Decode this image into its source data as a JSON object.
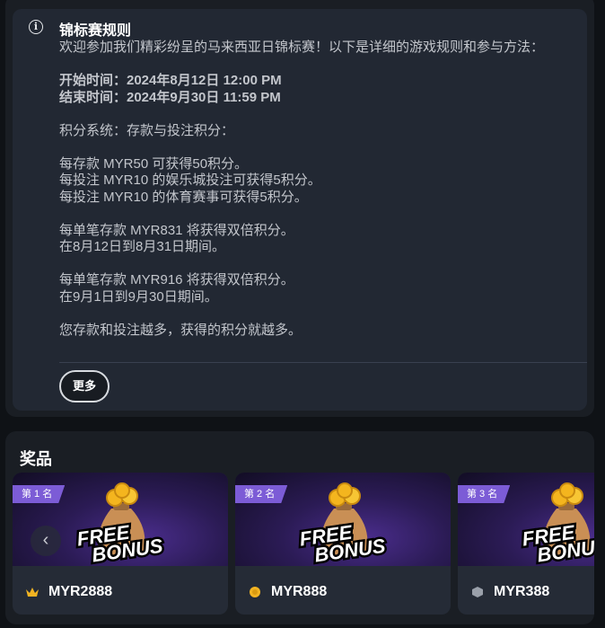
{
  "rules": {
    "title": "锦标赛规则",
    "intro": "欢迎参加我们精彩纷呈的马来西亚日锦标赛！以下是详细的游戏规则和参与方法：",
    "start_time": "开始时间：2024年8月12日 12:00 PM",
    "end_time": "结束时间：2024年9月30日 11:59 PM",
    "points_system": "积分系统：存款与投注积分：",
    "points_rules": [
      "每存款 MYR50 可获得50积分。",
      "每投注 MYR10 的娱乐城投注可获得5积分。",
      "每投注 MYR10 的体育赛事可获得5积分。"
    ],
    "double_1_line1": "每单笔存款 MYR831 将获得双倍积分。",
    "double_1_line2": "在8月12日到8月31日期间。",
    "double_2_line1": "每单笔存款 MYR916 将获得双倍积分。",
    "double_2_line2": "在9月1日到9月30日期间。",
    "closing": "您存款和投注越多，获得的积分就越多。",
    "more_button": "更多"
  },
  "prizes": {
    "title": "奖品",
    "banner_text_line1": "FREE",
    "banner_text_line2": "BONUS",
    "items": [
      {
        "rank": "第 1 名",
        "value": "MYR2888",
        "icon": "crown-icon",
        "color": "#f2b322"
      },
      {
        "rank": "第 2 名",
        "value": "MYR888",
        "icon": "gold-medal-icon",
        "color": "#f2b322"
      },
      {
        "rank": "第 3 名",
        "value": "MYR388",
        "icon": "hexagon-icon",
        "color": "#9aa0aa"
      }
    ],
    "nav_prev": "‹"
  }
}
